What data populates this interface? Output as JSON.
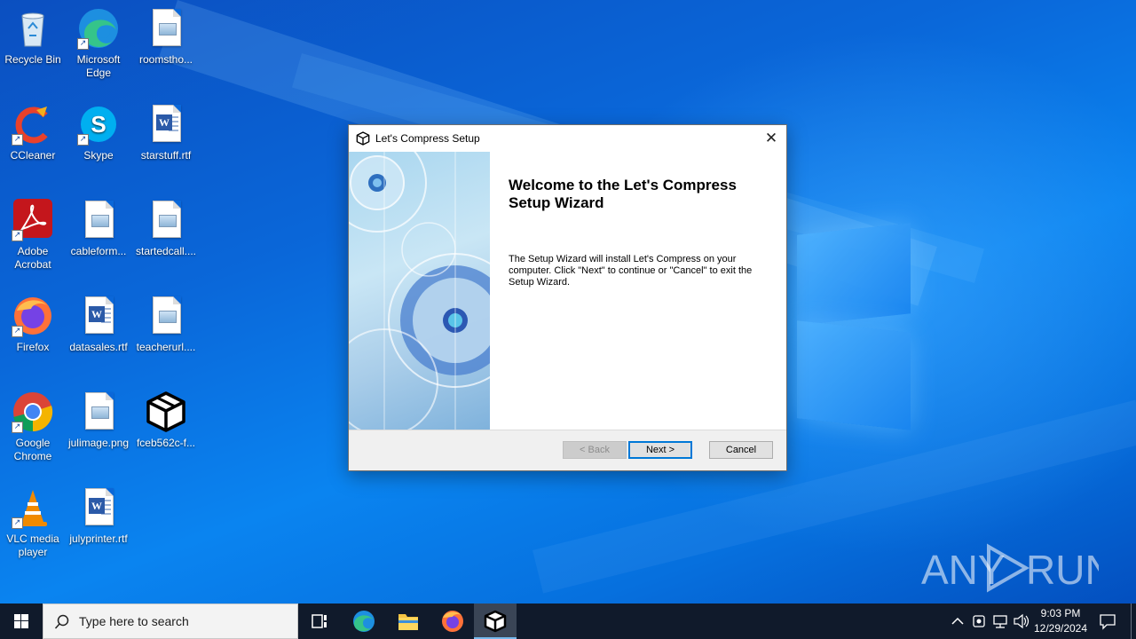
{
  "desktop": {
    "icons": [
      {
        "label": "Recycle Bin"
      },
      {
        "label": "Microsoft Edge"
      },
      {
        "label": "roomstho..."
      },
      {
        "label": "CCleaner"
      },
      {
        "label": "Skype"
      },
      {
        "label": "starstuff.rtf"
      },
      {
        "label": "Adobe Acrobat"
      },
      {
        "label": "cableform..."
      },
      {
        "label": "startedcall...."
      },
      {
        "label": "Firefox"
      },
      {
        "label": "datasales.rtf"
      },
      {
        "label": "teacherurl...."
      },
      {
        "label": "Google Chrome"
      },
      {
        "label": "julimage.png"
      },
      {
        "label": "fceb562c-f..."
      },
      {
        "label": "VLC media player"
      },
      {
        "label": "julyprinter.rtf"
      }
    ]
  },
  "dialog": {
    "title": "Let's Compress Setup",
    "heading": "Welcome to the Let's Compress Setup Wizard",
    "description": "The Setup Wizard will install Let's Compress on your computer.  Click \"Next\" to continue or \"Cancel\" to exit the Setup Wizard.",
    "back_label": "< Back",
    "next_label": "Next >",
    "cancel_label": "Cancel",
    "close_glyph": "✕"
  },
  "taskbar": {
    "search_placeholder": "Type here to search",
    "time": "9:03 PM",
    "date": "12/29/2024"
  },
  "watermark": {
    "text_left": "ANY",
    "text_right": "RUN"
  },
  "colors": {
    "accent": "#0078d7",
    "taskbar": "#101a2b",
    "desktop": "#0a67d9"
  }
}
